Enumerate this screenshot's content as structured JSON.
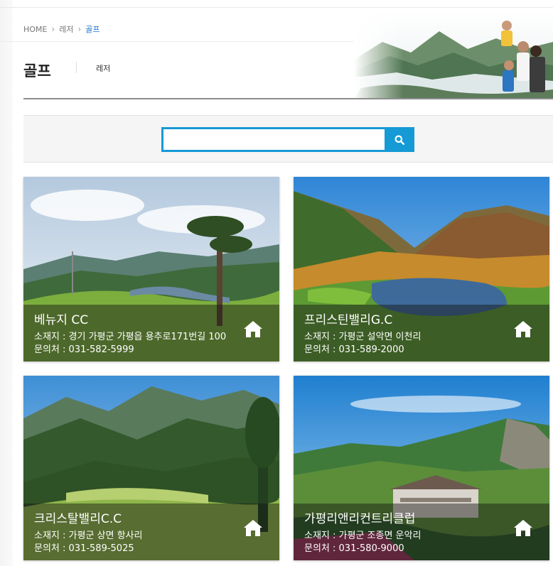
{
  "breadcrumb": {
    "home": "HOME",
    "level1": "레저",
    "current": "골프"
  },
  "page": {
    "title": "골프",
    "subnav": "레저"
  },
  "search": {
    "value": "",
    "placeholder": ""
  },
  "labels": {
    "address_prefix": "소재지 : ",
    "phone_prefix": "문의처 : "
  },
  "cards": [
    {
      "name": "베뉴지 CC",
      "address": "소재지 : 경기 가평군 가평읍 용추로171번길 100",
      "phone": "문의처 : 031-582-5999"
    },
    {
      "name": "프리스틴밸리G.C",
      "address": "소재지 : 가평군 설악면 이천리",
      "phone": "문의처 : 031-589-2000"
    },
    {
      "name": "크리스탈밸리C.C",
      "address": "소재지 : 가평군 상면 항사리",
      "phone": "문의처 : 031-589-5025"
    },
    {
      "name": "가평리앤리컨트리클럽",
      "address": "소재지 : 가평군 조종면 운악리",
      "phone": "문의처 : 031-580-9000"
    }
  ],
  "colors": {
    "accent": "#159ad6",
    "current_crumb": "#1a73c8"
  }
}
